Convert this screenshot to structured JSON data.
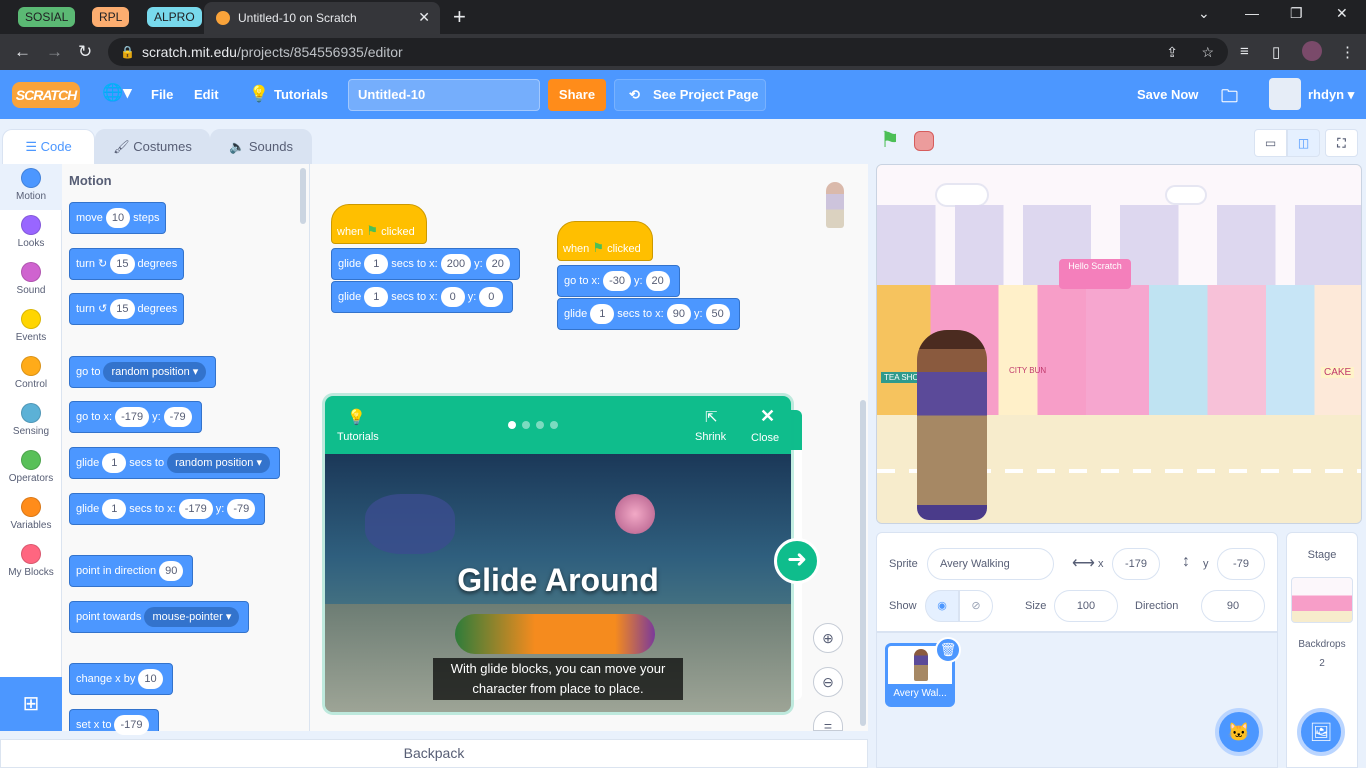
{
  "browser": {
    "tab_groups": [
      {
        "label": "SOSIAL",
        "color": "#5bb974"
      },
      {
        "label": "RPL",
        "color": "#fcad70"
      },
      {
        "label": "ALPRO",
        "color": "#78d9ec"
      }
    ],
    "active_tab_title": "Untitled-10 on Scratch",
    "url_host": "scratch.mit.edu",
    "url_path": "/projects/854556935/editor"
  },
  "menu": {
    "logo": "SCRATCH",
    "file": "File",
    "edit": "Edit",
    "tutorials": "Tutorials",
    "project_title": "Untitled-10",
    "share": "Share",
    "see_project_page": "See Project Page",
    "save_now": "Save Now",
    "username": "rhdyn"
  },
  "editor_tabs": {
    "code": "Code",
    "costumes": "Costumes",
    "sounds": "Sounds"
  },
  "categories": [
    {
      "label": "Motion",
      "color": "#4c97ff"
    },
    {
      "label": "Looks",
      "color": "#9966ff"
    },
    {
      "label": "Sound",
      "color": "#cf63cf"
    },
    {
      "label": "Events",
      "color": "#ffd500"
    },
    {
      "label": "Control",
      "color": "#ffab19"
    },
    {
      "label": "Sensing",
      "color": "#5cb1d6"
    },
    {
      "label": "Operators",
      "color": "#59c059"
    },
    {
      "label": "Variables",
      "color": "#ff8c1a"
    },
    {
      "label": "My Blocks",
      "color": "#ff6680"
    }
  ],
  "palette": {
    "heading": "Motion",
    "move": {
      "a": "move",
      "v": "10",
      "b": "steps"
    },
    "turn_right": {
      "a": "turn",
      "v": "15",
      "b": "degrees"
    },
    "turn_left": {
      "a": "turn",
      "v": "15",
      "b": "degrees"
    },
    "goto": {
      "a": "go to",
      "dd": "random position"
    },
    "gotoxy": {
      "a": "go to x:",
      "x": "-179",
      "b": "y:",
      "y": "-79"
    },
    "glide_rand": {
      "a": "glide",
      "v": "1",
      "b": "secs to",
      "dd": "random position"
    },
    "glide_xy": {
      "a": "glide",
      "v": "1",
      "b": "secs to x:",
      "x": "-179",
      "c": "y:",
      "y": "-79"
    },
    "point_dir": {
      "a": "point in direction",
      "v": "90"
    },
    "point_towards": {
      "a": "point towards",
      "dd": "mouse-pointer"
    },
    "change_x": {
      "a": "change x by",
      "v": "10"
    },
    "set_x": {
      "a": "set x to",
      "v": "-179"
    }
  },
  "scripts": {
    "s1": {
      "hat_a": "when",
      "hat_b": "clicked",
      "g1": {
        "a": "glide",
        "v": "1",
        "b": "secs to x:",
        "x": "200",
        "c": "y:",
        "y": "20"
      },
      "g2": {
        "a": "glide",
        "v": "1",
        "b": "secs to x:",
        "x": "0",
        "c": "y:",
        "y": "0"
      }
    },
    "s2": {
      "hat_a": "when",
      "hat_b": "clicked",
      "goto": {
        "a": "go to x:",
        "x": "-30",
        "b": "y:",
        "y": "20"
      },
      "g1": {
        "a": "glide",
        "v": "1",
        "b": "secs to x:",
        "x": "90",
        "c": "y:",
        "y": "50"
      }
    }
  },
  "tutorial": {
    "label": "Tutorials",
    "shrink": "Shrink",
    "close": "Close",
    "video_title": "Glide Around",
    "caption": "With glide blocks, you can move your character from place to place.",
    "dots_total": 4,
    "dots_active": 1
  },
  "backpack": "Backpack",
  "sprite_info": {
    "sprite_label": "Sprite",
    "sprite_name": "Avery Walking",
    "x_label": "x",
    "x": "-179",
    "y_label": "y",
    "y": "-79",
    "show_label": "Show",
    "size_label": "Size",
    "size": "100",
    "direction_label": "Direction",
    "direction": "90"
  },
  "sprite_thumb_label": "Avery Wal...",
  "stage_pane": {
    "title": "Stage",
    "backdrops_label": "Backdrops",
    "backdrops_count": "2"
  },
  "stage_scene": {
    "sign_tea": "TEA SHOP",
    "sign_city": "CITY BUN",
    "sign_cake": "CAKE",
    "sign_hello": "Hello",
    "sign_scratch": "Scratch"
  }
}
